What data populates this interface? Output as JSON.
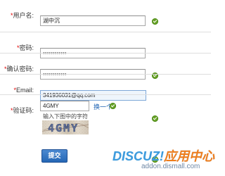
{
  "form": {
    "fields": [
      {
        "required_marker": "*",
        "label": "用户名:",
        "value": "湖中沉"
      },
      {
        "required_marker": "*",
        "label": "密码:",
        "value": "••••••••••••"
      },
      {
        "required_marker": "*",
        "label": "确认密码:",
        "value": "••••••••••••"
      },
      {
        "required_marker": "*",
        "label": "Email:",
        "value": "341936031@qq.com"
      }
    ],
    "captcha": {
      "required_marker": "*",
      "label": "验证码:",
      "value": "4GMY",
      "swap_label": "换一个",
      "hint": "输入下图中的字符",
      "image_text": "4GMY"
    },
    "submit_label": "提交"
  },
  "watermark": {
    "brand_main": "DISCUZ!",
    "brand_accent": "应用中心",
    "url": "addon.dismall.com"
  },
  "colors": {
    "label": "#333333",
    "required": "#e00000",
    "success": "#6aa32a",
    "link": "#1c62b3",
    "submit": "#2567b5",
    "watermark_blue": "#3c9bdd",
    "watermark_orange": "#ef7d1b"
  },
  "icons": {
    "success": "check-circle-icon"
  }
}
